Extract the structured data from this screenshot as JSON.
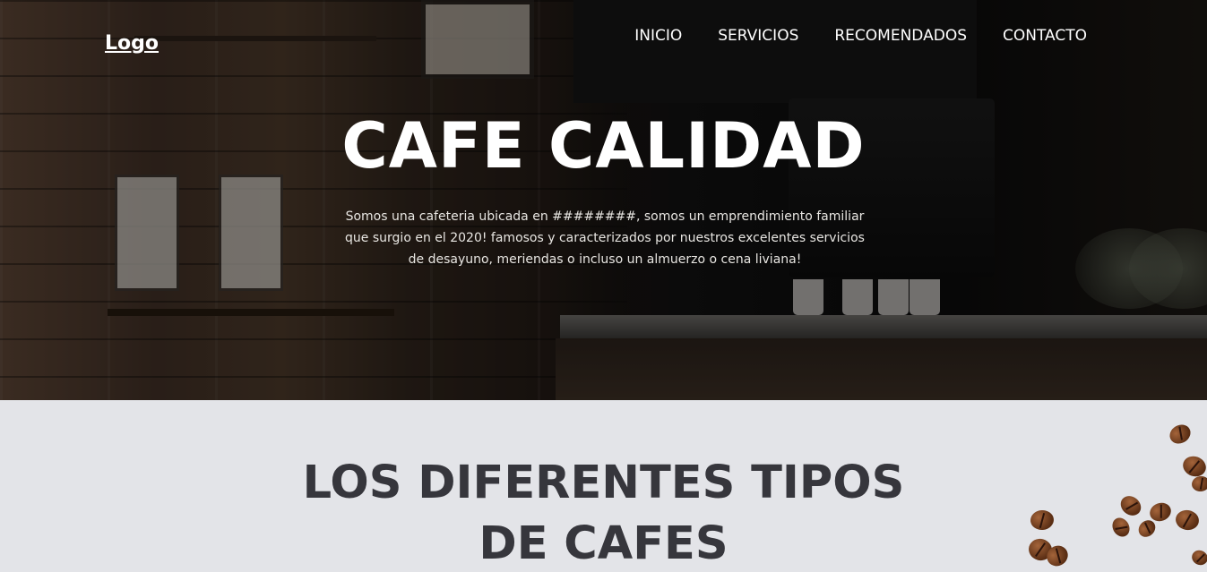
{
  "header": {
    "logo": "Logo",
    "nav": [
      {
        "label": "INICIO"
      },
      {
        "label": "SERVICIOS"
      },
      {
        "label": "RECOMENDADOS"
      },
      {
        "label": "CONTACTO"
      }
    ]
  },
  "hero": {
    "title": "CAFE CALIDAD",
    "description": "Somos una cafeteria ubicada en ########, somos un emprendimiento familiar que surgio en el 2020! famosos y caracterizados por nuestros excelentes servicios de desayuno, meriendas o incluso un almuerzo o cena liviana!"
  },
  "section": {
    "title_line1": "LOS DIFERENTES TIPOS",
    "title_line2": "DE CAFES"
  },
  "colors": {
    "section_bg": "#e3e4e8",
    "section_title": "#36363c",
    "hero_text": "#ffffff"
  }
}
